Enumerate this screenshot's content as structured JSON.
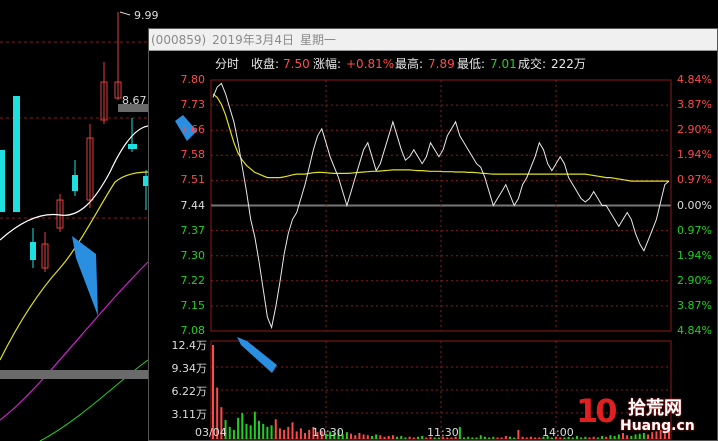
{
  "background_chart": {
    "high_marker": "9.99",
    "price_label": "8.67"
  },
  "popup": {
    "title": {
      "code": "(000859)",
      "date": "2019年3月4日",
      "weekday": "星期一"
    },
    "info": {
      "mode": "分时",
      "close_label": "收盘:",
      "close_value": "7.50",
      "change_label": "涨幅:",
      "change_value": "+0.81%",
      "high_label": "最高:",
      "high_value": "7.89",
      "low_label": "最低:",
      "low_value": "7.01",
      "volume_label": "成交:",
      "volume_value": "222万"
    },
    "colors": {
      "up": "#ff4a4a",
      "down": "#20d020",
      "price_line": "#e8e8e8",
      "avg_line": "#e0e020",
      "arrow": "#2a8fe0"
    }
  },
  "chart_data": {
    "type": "line",
    "title": "",
    "xlabel": "",
    "ylabel": "",
    "x_tick_labels": [
      "03/04",
      "10:30",
      "11:30",
      "14:00"
    ],
    "price_axis_left": [
      "7.80",
      "7.73",
      "7.66",
      "7.58",
      "7.51",
      "7.44",
      "7.37",
      "7.30",
      "7.22",
      "7.15",
      "7.08"
    ],
    "percent_axis_right": [
      "4.84%",
      "3.87%",
      "2.90%",
      "1.94%",
      "0.97%",
      "0.00%",
      "0.97%",
      "1.94%",
      "2.90%",
      "3.87%",
      "4.84%"
    ],
    "ylim": [
      7.08,
      7.8
    ],
    "prev_close": 7.44,
    "volume_axis_labels": [
      "12.4万",
      "9.34万",
      "6.22万",
      "3.11万"
    ],
    "volume_ylim": [
      0,
      12.4
    ],
    "series": [
      {
        "values": [
          7.75,
          7.78,
          7.79,
          7.76,
          7.72,
          7.68,
          7.62,
          7.55,
          7.48,
          7.4,
          7.35,
          7.28,
          7.2,
          7.12,
          7.09,
          7.15,
          7.22,
          7.3,
          7.36,
          7.4,
          7.42,
          7.46,
          7.5,
          7.55,
          7.6,
          7.64,
          7.66,
          7.62,
          7.58,
          7.55,
          7.52,
          7.48,
          7.44,
          7.48,
          7.52,
          7.56,
          7.6,
          7.62,
          7.58,
          7.54,
          7.56,
          7.6,
          7.64,
          7.68,
          7.64,
          7.6,
          7.57,
          7.58,
          7.6,
          7.58,
          7.56,
          7.58,
          7.62,
          7.6,
          7.58,
          7.6,
          7.64,
          7.66,
          7.68,
          7.64,
          7.62,
          7.6,
          7.58,
          7.56,
          7.55,
          7.52,
          7.48,
          7.44,
          7.46,
          7.48,
          7.5,
          7.47,
          7.44,
          7.46,
          7.5,
          7.52,
          7.55,
          7.58,
          7.62,
          7.6,
          7.56,
          7.54,
          7.56,
          7.58,
          7.56,
          7.52,
          7.5,
          7.48,
          7.46,
          7.45,
          7.46,
          7.48,
          7.46,
          7.44,
          7.44,
          7.42,
          7.4,
          7.38,
          7.4,
          7.42,
          7.4,
          7.36,
          7.33,
          7.31,
          7.34,
          7.37,
          7.4,
          7.45,
          7.5,
          7.51
        ]
      },
      {
        "values": [
          7.76,
          7.75,
          7.73,
          7.7,
          7.66,
          7.62,
          7.59,
          7.57,
          7.555,
          7.545,
          7.535,
          7.53,
          7.525,
          7.52,
          7.52,
          7.52,
          7.52,
          7.522,
          7.525,
          7.528,
          7.53,
          7.53,
          7.53,
          7.532,
          7.534,
          7.535,
          7.535,
          7.534,
          7.533,
          7.532,
          7.532,
          7.532,
          7.532,
          7.533,
          7.534,
          7.535,
          7.536,
          7.537,
          7.538,
          7.538,
          7.539,
          7.54,
          7.541,
          7.542,
          7.542,
          7.542,
          7.542,
          7.542,
          7.541,
          7.54,
          7.54,
          7.539,
          7.538,
          7.538,
          7.538,
          7.537,
          7.537,
          7.537,
          7.536,
          7.536,
          7.536,
          7.535,
          7.535,
          7.534,
          7.533,
          7.532,
          7.531,
          7.53,
          7.53,
          7.53,
          7.53,
          7.53,
          7.53,
          7.53,
          7.53,
          7.53,
          7.53,
          7.53,
          7.53,
          7.53,
          7.53,
          7.53,
          7.53,
          7.53,
          7.53,
          7.53,
          7.53,
          7.53,
          7.53,
          7.53,
          7.528,
          7.526,
          7.524,
          7.522,
          7.52,
          7.52,
          7.518,
          7.516,
          7.514,
          7.512,
          7.51,
          7.51,
          7.51,
          7.51,
          7.51,
          7.51,
          7.51,
          7.51,
          7.51,
          7.51
        ]
      }
    ],
    "volume": [
      12.4,
      6.8,
      4.2,
      2.5,
      1.6,
      1.2,
      2.8,
      3.4,
      2.0,
      1.8,
      3.6,
      2.4,
      2.0,
      1.6,
      1.8,
      2.6,
      1.4,
      1.2,
      1.6,
      2.2,
      1.0,
      1.4,
      0.8,
      1.2,
      1.6,
      0.9,
      1.1,
      0.7,
      1.0,
      0.8,
      1.2,
      0.6,
      0.9,
      0.7,
      0.5,
      0.8,
      0.6,
      0.5,
      0.4,
      0.6,
      0.5,
      0.3,
      0.4,
      0.5,
      0.3,
      0.4,
      0.2,
      0.3,
      0.2,
      0.3,
      0.4,
      0.2,
      0.3,
      0.2,
      0.2,
      0.3,
      0.2,
      0.2,
      0.3,
      1.6,
      0.2,
      0.3,
      0.2,
      0.2,
      0.5,
      0.3,
      0.2,
      0.3,
      0.2,
      0.2,
      0.4,
      0.3,
      0.2,
      1.2,
      0.3,
      0.2,
      0.3,
      0.2,
      0.2,
      0.3,
      0.4,
      0.2,
      0.3,
      0.2,
      0.2,
      0.3,
      0.2,
      0.4,
      0.2,
      0.3,
      0.2,
      0.3,
      0.2,
      0.4,
      0.3,
      0.5,
      0.4,
      0.6,
      0.8,
      0.5,
      0.4,
      0.6,
      0.7,
      0.8,
      0.6,
      0.9,
      1.0,
      1.2,
      0.8,
      1.4
    ]
  },
  "watermark": {
    "number": "10",
    "cn": "拾荒网",
    "en": "Huang.cn"
  }
}
